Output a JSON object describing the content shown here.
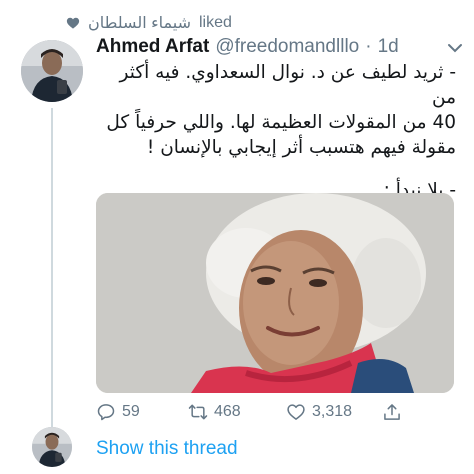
{
  "liked_by": {
    "user": "شيماء السلطان",
    "action": "liked"
  },
  "tweet": {
    "author_name": "Ahmed Arfat",
    "handle": "@freedomandlllo",
    "separator": "·",
    "time": "1d",
    "text_lines": [
      "- ثريد لطيف عن د. نوال السعداوي. فيه أكثر من",
      "40 من المقولات العظيمة لها. واللي حرفياً كل",
      "مقولة فيهم هتسبب أثر إيجابي بالإنسان !",
      "- يلا نبدأ :"
    ]
  },
  "actions": {
    "replies": "59",
    "retweets": "468",
    "likes": "3,318"
  },
  "show_thread_label": "Show this thread",
  "icons": [
    "heart-icon",
    "chevron-down-icon",
    "reply-icon",
    "retweet-icon",
    "like-icon",
    "share-icon"
  ],
  "colors": {
    "accent": "#1da1f2",
    "secondary_text": "#657786",
    "thread_line": "#cfd9de"
  }
}
